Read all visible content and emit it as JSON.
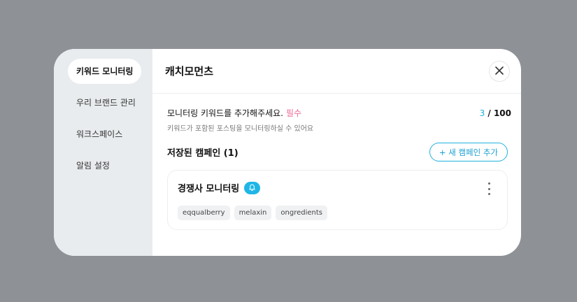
{
  "sidebar": {
    "items": [
      {
        "label": "키워드 모니터링",
        "active": true
      },
      {
        "label": "우리 브랜드 관리",
        "active": false
      },
      {
        "label": "워크스페이스",
        "active": false
      },
      {
        "label": "알림 설정",
        "active": false
      }
    ]
  },
  "header": {
    "title": "캐치모먼츠",
    "close_icon": "close-icon"
  },
  "keyword_section": {
    "title": "모니터링 키워드를 추가해주세요.",
    "required": "필수",
    "description": "키워드가 포함된 포스팅을 모니터링하실 수 있어요",
    "count_current": "3",
    "count_max": "/ 100"
  },
  "campaigns": {
    "title": "저장된 캠페인 (1)",
    "add_button": "+ 새 캠페인 추가",
    "items": [
      {
        "name": "경쟁사 모니터링",
        "tags": [
          "eqqualberry",
          "melaxin",
          "ongredients"
        ]
      }
    ]
  },
  "colors": {
    "accent": "#21b1e0",
    "required": "#f06a9a",
    "sidebar_bg": "#e9ecee",
    "backdrop": "#8e9196"
  }
}
